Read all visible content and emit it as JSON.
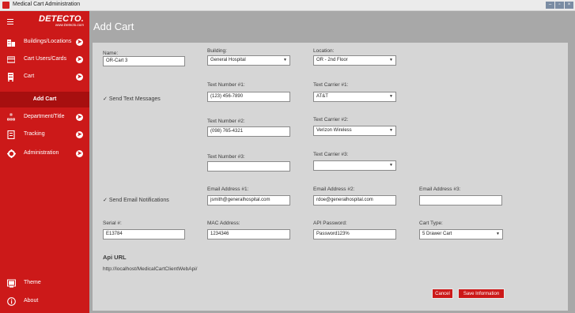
{
  "window": {
    "title": "Medical Cart Administration",
    "controls": [
      "–",
      "▫",
      "×"
    ]
  },
  "logo": {
    "brand": "DETECTO.",
    "url": "www.Detecto.com"
  },
  "sidebar": {
    "items": [
      {
        "label": "Buildings/Locations",
        "icon": "building-icon"
      },
      {
        "label": "Cart Users/Cards",
        "icon": "card-icon"
      },
      {
        "label": "Cart",
        "icon": "cart-icon"
      },
      {
        "label": "Add Cart",
        "icon": ""
      },
      {
        "label": "Department/Title",
        "icon": "department-icon"
      },
      {
        "label": "Tracking",
        "icon": "tracking-icon"
      },
      {
        "label": "Administration",
        "icon": "gear-icon"
      }
    ],
    "bottom": [
      {
        "label": "Theme",
        "icon": "theme-icon"
      },
      {
        "label": "About",
        "icon": "info-icon"
      }
    ]
  },
  "page": {
    "title": "Add Cart"
  },
  "form": {
    "name": {
      "label": "Name:",
      "value": "OR-Cart 3"
    },
    "building": {
      "label": "Building:",
      "value": "General Hospital"
    },
    "location": {
      "label": "Location:",
      "value": "OR - 2nd Floor"
    },
    "send_text": {
      "label": "Send Text Messages",
      "checked": true
    },
    "text1": {
      "label": "Text Number #1:",
      "value": "(123) 456-7890"
    },
    "carrier1": {
      "label": "Text Carrier #1:",
      "value": "AT&T"
    },
    "text2": {
      "label": "Text Number #2:",
      "value": "(098) 765-4321"
    },
    "carrier2": {
      "label": "Text Carrier #2:",
      "value": "Verizon Wireless"
    },
    "text3": {
      "label": "Text Number #3:",
      "value": ""
    },
    "carrier3": {
      "label": "Text Carrier #3:",
      "value": ""
    },
    "send_email": {
      "label": "Send Email Notifications",
      "checked": true
    },
    "email1": {
      "label": "Email Address #1:",
      "value": "jsmith@generalhospital.com"
    },
    "email2": {
      "label": "Email Address #2:",
      "value": "rdoe@generalhospital.com"
    },
    "email3": {
      "label": "Email Address #3:",
      "value": ""
    },
    "serial": {
      "label": "Serial #:",
      "value": "E13784"
    },
    "mac": {
      "label": "MAC Address:",
      "value": "1234346"
    },
    "api_password": {
      "label": "API Password:",
      "value": "Password123%"
    },
    "cart_type": {
      "label": "Cart Type:",
      "value": "5 Drawer Cart"
    },
    "api_url": {
      "label": "Api URL",
      "value": "http://localhost/MedicalCartClientWebApi/"
    }
  },
  "buttons": {
    "cancel": "Cancel",
    "save": "Save Information"
  },
  "colors": {
    "accent": "#cc1919",
    "accent_dark": "#a70f0f",
    "background": "#a8a8a8",
    "card": "#d6d6d6"
  }
}
